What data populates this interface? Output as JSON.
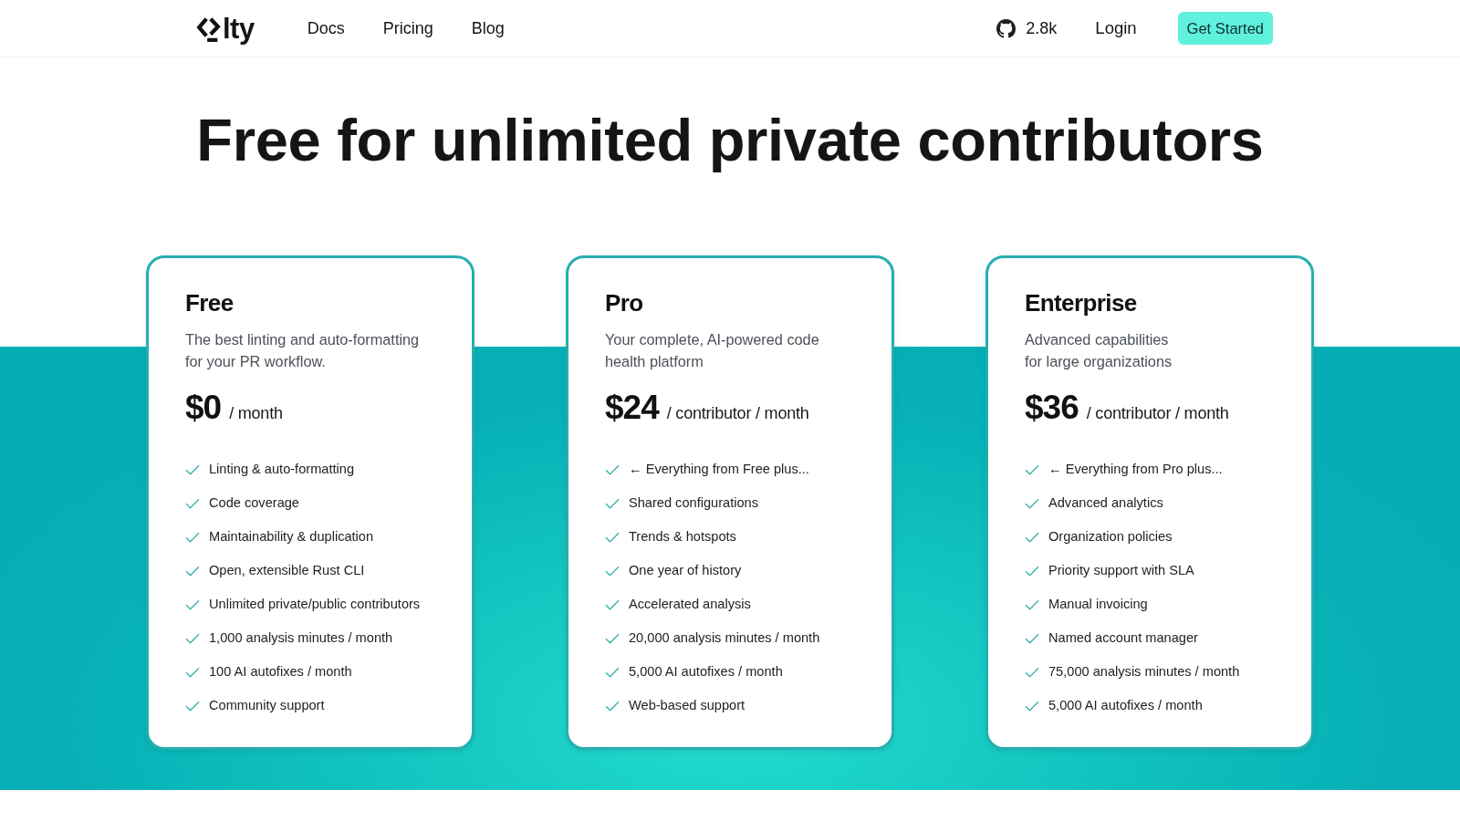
{
  "nav": {
    "logo": {
      "wordmark": "lty"
    },
    "links": [
      {
        "label": "Docs"
      },
      {
        "label": "Pricing"
      },
      {
        "label": "Blog"
      }
    ],
    "github_stars": "2.8k",
    "login": "Login",
    "cta": "Get Started"
  },
  "hero": {
    "title": "Free for unlimited private contributors"
  },
  "plans": [
    {
      "name": "Free",
      "description_lines": [
        "The best linting and auto-formatting",
        "for your PR workflow."
      ],
      "price": "$0",
      "period": "/ month",
      "features": [
        "Linting & auto-formatting",
        "Code coverage",
        "Maintainability & duplication",
        "Open, extensible Rust CLI",
        "Unlimited private/public contributors",
        "1,000 analysis minutes / month",
        "100 AI autofixes / month",
        "Community support"
      ]
    },
    {
      "name": "Pro",
      "description_lines": [
        "Your complete, AI-powered code",
        "health platform"
      ],
      "price": "$24",
      "period": "/ contributor / month",
      "features": [
        "← Everything from Free plus...",
        "Shared configurations",
        "Trends & hotspots",
        "One year of history",
        "Accelerated analysis",
        "20,000 analysis minutes / month",
        "5,000 AI autofixes / month",
        "Web-based support"
      ]
    },
    {
      "name": "Enterprise",
      "description_lines": [
        "Advanced capabilities",
        "for large organizations"
      ],
      "price": "$36",
      "period": "/ contributor / month",
      "features": [
        "← Everything from Pro plus...",
        "Advanced analytics",
        "Organization policies",
        "Priority support with SLA",
        "Manual invoicing",
        "Named account manager",
        "75,000 analysis minutes / month",
        "5,000 AI autofixes / month"
      ]
    }
  ]
}
